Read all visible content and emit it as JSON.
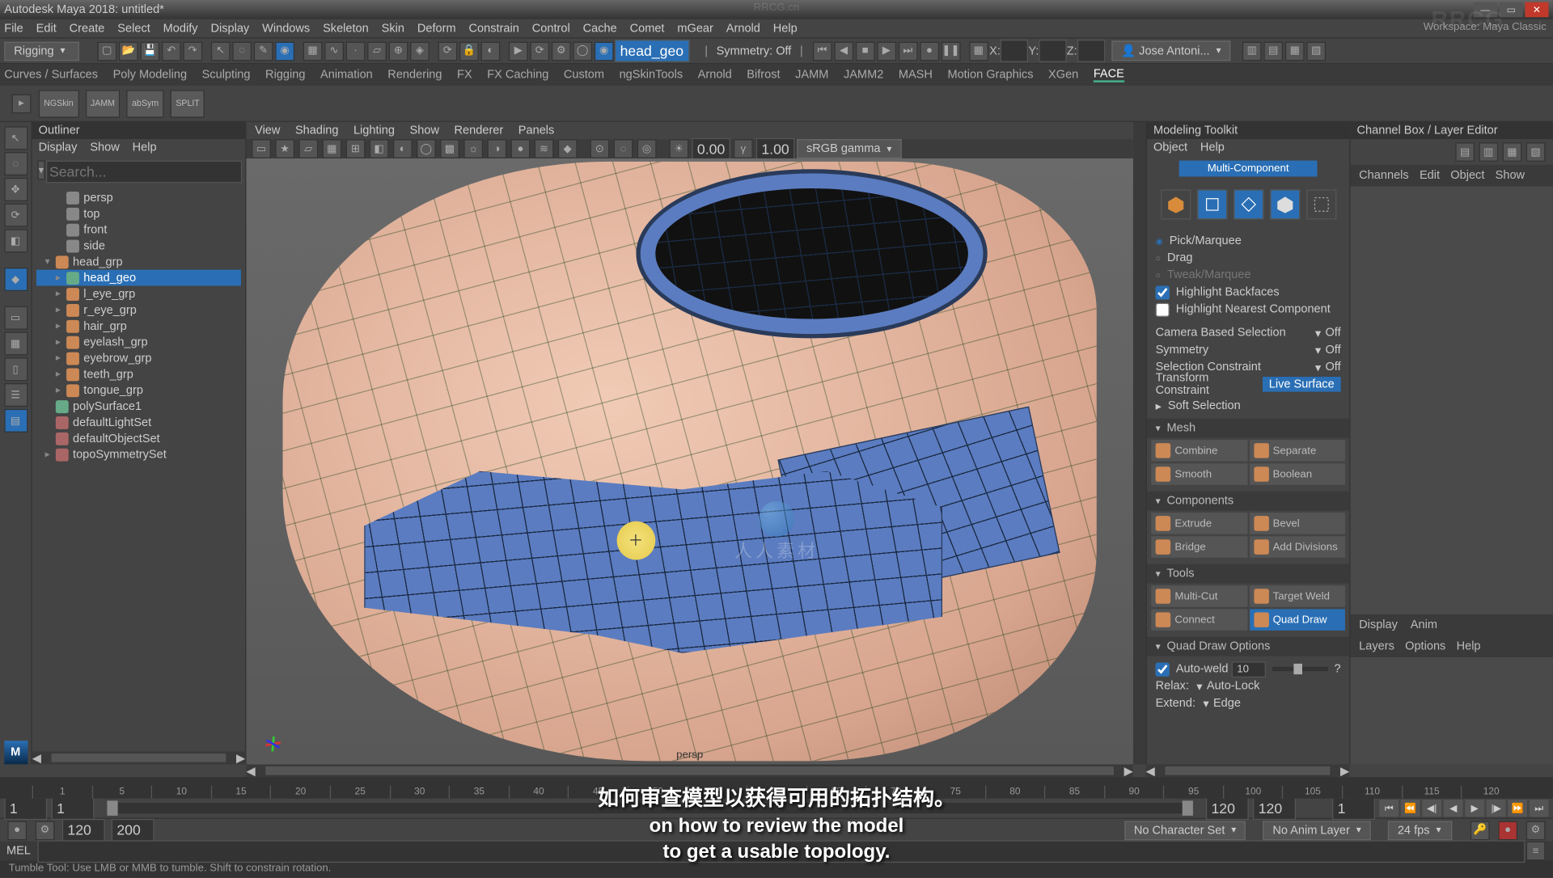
{
  "title": "Autodesk Maya 2018: untitled*",
  "watermark_top": "RRCG.cn",
  "workspace": "Workspace:  Maya Classic",
  "menu": [
    "File",
    "Edit",
    "Create",
    "Select",
    "Modify",
    "Display",
    "Windows",
    "Skeleton",
    "Skin",
    "Deform",
    "Constrain",
    "Control",
    "Cache",
    "Comet",
    "mGear",
    "Arnold",
    "Help"
  ],
  "mode_dropdown": "Rigging",
  "searchfield": "head_geo",
  "symmetry": "Symmetry: Off",
  "xyz": {
    "x": "X:",
    "y": "Y:",
    "z": "Z:"
  },
  "user": "Jose Antoni...",
  "shelf_tabs": [
    "Curves / Surfaces",
    "Poly Modeling",
    "Sculpting",
    "Rigging",
    "Animation",
    "Rendering",
    "FX",
    "FX Caching",
    "Custom",
    "ngSkinTools",
    "Arnold",
    "Bifrost",
    "JAMM",
    "JAMM2",
    "MASH",
    "Motion Graphics",
    "XGen",
    "FACE"
  ],
  "shelf_active": "FACE",
  "shelf_icons": [
    "NGSkin",
    "JAMM",
    "abSym",
    "SPLIT"
  ],
  "outliner": {
    "title": "Outliner",
    "menus": [
      "Display",
      "Show",
      "Help"
    ],
    "search_ph": "Search...",
    "items": [
      {
        "k": "cam",
        "label": "persp",
        "i": 1
      },
      {
        "k": "cam",
        "label": "top",
        "i": 1
      },
      {
        "k": "cam",
        "label": "front",
        "i": 1
      },
      {
        "k": "cam",
        "label": "side",
        "i": 1
      },
      {
        "k": "grp",
        "label": "head_grp",
        "i": 0,
        "disc": "▾"
      },
      {
        "k": "mesh",
        "label": "head_geo",
        "i": 1,
        "disc": "▸",
        "sel": true
      },
      {
        "k": "grp",
        "label": "l_eye_grp",
        "i": 1,
        "disc": "▸"
      },
      {
        "k": "grp",
        "label": "r_eye_grp",
        "i": 1,
        "disc": "▸"
      },
      {
        "k": "grp",
        "label": "hair_grp",
        "i": 1,
        "disc": "▸"
      },
      {
        "k": "grp",
        "label": "eyelash_grp",
        "i": 1,
        "disc": "▸"
      },
      {
        "k": "grp",
        "label": "eyebrow_grp",
        "i": 1,
        "disc": "▸"
      },
      {
        "k": "grp",
        "label": "teeth_grp",
        "i": 1,
        "disc": "▸"
      },
      {
        "k": "grp",
        "label": "tongue_grp",
        "i": 1,
        "disc": "▸"
      },
      {
        "k": "mesh",
        "label": "polySurface1",
        "i": 0
      },
      {
        "k": "set",
        "label": "defaultLightSet",
        "i": 0
      },
      {
        "k": "set",
        "label": "defaultObjectSet",
        "i": 0
      },
      {
        "k": "set",
        "label": "topoSymmetrySet",
        "i": 0,
        "disc": "▸"
      }
    ]
  },
  "viewport": {
    "menus": [
      "View",
      "Shading",
      "Lighting",
      "Show",
      "Renderer",
      "Panels"
    ],
    "num1": "0.00",
    "num2": "1.00",
    "colorspace": "sRGB gamma",
    "camera": "persp"
  },
  "mtk": {
    "title": "Modeling Toolkit",
    "menus": [
      "Object",
      "Help"
    ],
    "multicomp": "Multi-Component",
    "sel_modes": [
      {
        "label": "Pick/Marquee",
        "on": true
      },
      {
        "label": "Drag",
        "on": false
      },
      {
        "label": "Tweak/Marquee",
        "on": false
      }
    ],
    "checks": [
      {
        "label": "Highlight Backfaces",
        "on": true
      },
      {
        "label": "Highlight Nearest Component",
        "on": false
      }
    ],
    "camera_sel": {
      "label": "Camera Based Selection",
      "val": "Off"
    },
    "symmetry": {
      "label": "Symmetry",
      "val": "Off"
    },
    "selconst": {
      "label": "Selection Constraint",
      "val": "Off"
    },
    "transconst": {
      "label": "Transform Constraint",
      "val": "Live Surface"
    },
    "soft": "Soft Selection",
    "sections": {
      "mesh": {
        "title": "Mesh",
        "btns": [
          [
            "Combine",
            "Separate"
          ],
          [
            "Smooth",
            "Boolean"
          ]
        ]
      },
      "comp": {
        "title": "Components",
        "btns": [
          [
            "Extrude",
            "Bevel"
          ],
          [
            "Bridge",
            "Add Divisions"
          ]
        ]
      },
      "tools": {
        "title": "Tools",
        "btns": [
          [
            "Multi-Cut",
            "Target Weld"
          ],
          [
            "Connect",
            "Quad Draw"
          ]
        ],
        "sel": "Quad Draw"
      },
      "quad": {
        "title": "Quad Draw Options",
        "autoweld": "Auto-weld",
        "autoweld_val": "10",
        "relax": "Relax:",
        "relax_val": "Auto-Lock",
        "extend": "Extend:",
        "extend_val": "Edge"
      }
    }
  },
  "chbox": {
    "title": "Channel Box / Layer Editor",
    "tabs": [
      "Channels",
      "Edit",
      "Object",
      "Show"
    ],
    "lower": [
      "Display",
      "Anim"
    ],
    "lower2": [
      "Layers",
      "Options",
      "Help"
    ]
  },
  "timeline": {
    "ticks": [
      "1",
      "5",
      "10",
      "15",
      "20",
      "25",
      "30",
      "35",
      "40",
      "45",
      "50",
      "55",
      "60",
      "65",
      "70",
      "75",
      "80",
      "85",
      "90",
      "95",
      "100",
      "105",
      "110",
      "115",
      "120"
    ],
    "start": "1",
    "start2": "1",
    "end": "120",
    "end2": "120",
    "cur": "1"
  },
  "bottom": {
    "nochar": "No Character Set",
    "noanim": "No Anim Layer",
    "fps": "24 fps",
    "val1": "120",
    "val2": "200"
  },
  "cmd": {
    "label": "MEL"
  },
  "status": "Tumble Tool: Use LMB or MMB to tumble. Shift to constrain rotation.",
  "subs": {
    "zh": "如何审查模型以获得可用的拓扑结构。",
    "en1": "on how to review the model",
    "en2": "to get a usable topology."
  },
  "logo_text": "人人素材"
}
